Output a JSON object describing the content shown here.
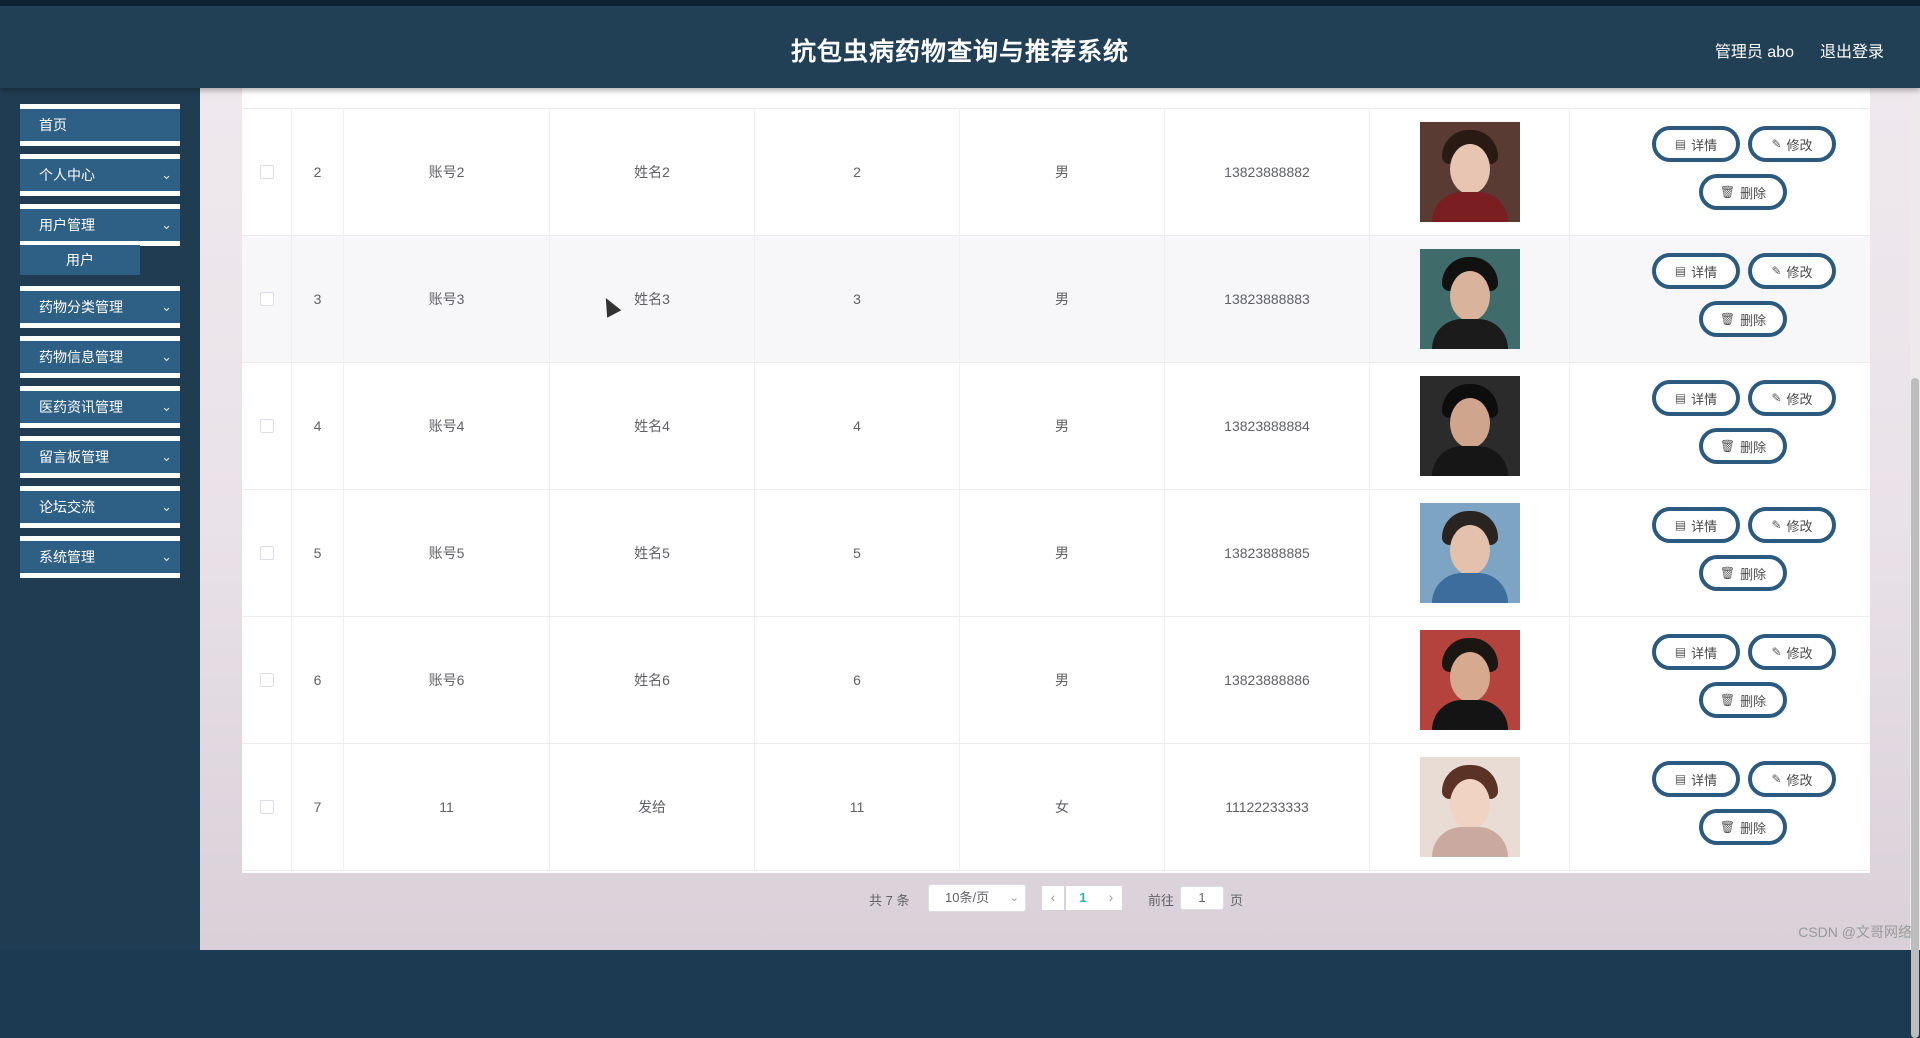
{
  "header": {
    "title": "抗包虫病药物查询与推荐系统",
    "user": "管理员 abo",
    "logout": "退出登录"
  },
  "sidebar": {
    "items": [
      {
        "label": "首页",
        "has_chevron": false
      },
      {
        "label": "个人中心",
        "has_chevron": true
      },
      {
        "label": "用户管理",
        "has_chevron": true
      },
      {
        "label": "药物分类管理",
        "has_chevron": true
      },
      {
        "label": "药物信息管理",
        "has_chevron": true
      },
      {
        "label": "医药资讯管理",
        "has_chevron": true
      },
      {
        "label": "留言板管理",
        "has_chevron": true
      },
      {
        "label": "论坛交流",
        "has_chevron": true
      },
      {
        "label": "系统管理",
        "has_chevron": true
      }
    ],
    "subitem": "用户",
    "chevron": "⌄"
  },
  "table": {
    "rows": [
      {
        "index": "2",
        "account": "账号2",
        "name": "姓名2",
        "age": "2",
        "gender": "男",
        "phone": "13823888882"
      },
      {
        "index": "3",
        "account": "账号3",
        "name": "姓名3",
        "age": "3",
        "gender": "男",
        "phone": "13823888883"
      },
      {
        "index": "4",
        "account": "账号4",
        "name": "姓名4",
        "age": "4",
        "gender": "男",
        "phone": "13823888884"
      },
      {
        "index": "5",
        "account": "账号5",
        "name": "姓名5",
        "age": "5",
        "gender": "男",
        "phone": "13823888885"
      },
      {
        "index": "6",
        "account": "账号6",
        "name": "姓名6",
        "age": "6",
        "gender": "男",
        "phone": "13823888886"
      },
      {
        "index": "7",
        "account": "11",
        "name": "发给",
        "age": "11",
        "gender": "女",
        "phone": "11122233333"
      }
    ],
    "actions": {
      "detail": "详情",
      "edit": "修改",
      "delete": "删除"
    },
    "icons": {
      "detail": "▤",
      "edit": "✎",
      "delete": "🗑"
    }
  },
  "pagination": {
    "total": "共 7 条",
    "page_size": "10条/页",
    "current_page": "1",
    "goto_label": "前往",
    "goto_value": "1",
    "page_suffix": "页",
    "prev": "‹",
    "next": "›"
  },
  "watermark": "CSDN @文哥网络",
  "colors": {
    "header_bg": "#213f55",
    "menu_bg": "#2e5f84",
    "button_border": "#2c5a7e",
    "page_active": "#2bb5a5"
  }
}
